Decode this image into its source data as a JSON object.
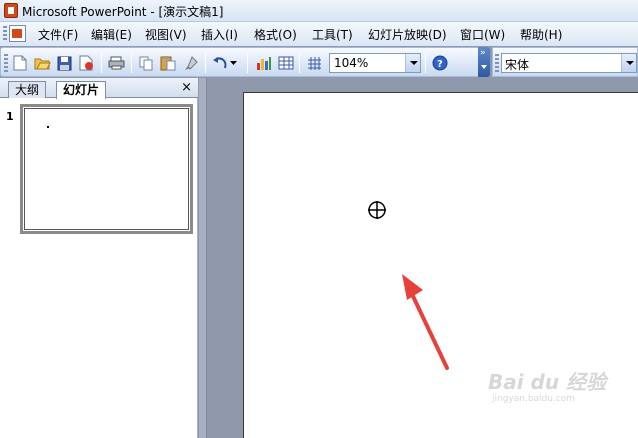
{
  "window": {
    "title": "Microsoft PowerPoint - [演示文稿1]"
  },
  "menu": {
    "items": [
      {
        "label": "文件(F)"
      },
      {
        "label": "编辑(E)"
      },
      {
        "label": "视图(V)"
      },
      {
        "label": "插入(I)"
      },
      {
        "label": "格式(O)"
      },
      {
        "label": "工具(T)"
      },
      {
        "label": "幻灯片放映(D)"
      },
      {
        "label": "窗口(W)"
      },
      {
        "label": "帮助(H)"
      }
    ]
  },
  "toolbar": {
    "zoom_value": "104%",
    "icons": [
      "new-icon",
      "open-icon",
      "save-icon",
      "permission-icon",
      "print-icon",
      "copy-icon",
      "paste-icon",
      "format-painter-icon",
      "undo-icon",
      "chart-icon",
      "table-icon",
      "grid-icon",
      "help-icon"
    ]
  },
  "formatting": {
    "font_name": "宋体"
  },
  "left_pane": {
    "tabs": [
      {
        "label": "大纲"
      },
      {
        "label": "幻灯片"
      }
    ],
    "close_label": "×",
    "slides": [
      {
        "number": "1"
      }
    ]
  },
  "annotation": {
    "arrow_color": "#e8403a"
  },
  "watermark": {
    "brand": "Bai du 经验",
    "url": "jingyan.baidu.com"
  },
  "colors": {
    "workspace_bg": "#8f99ab",
    "toolbar_top": "#f7faff",
    "toolbar_bottom": "#c9daf1"
  }
}
